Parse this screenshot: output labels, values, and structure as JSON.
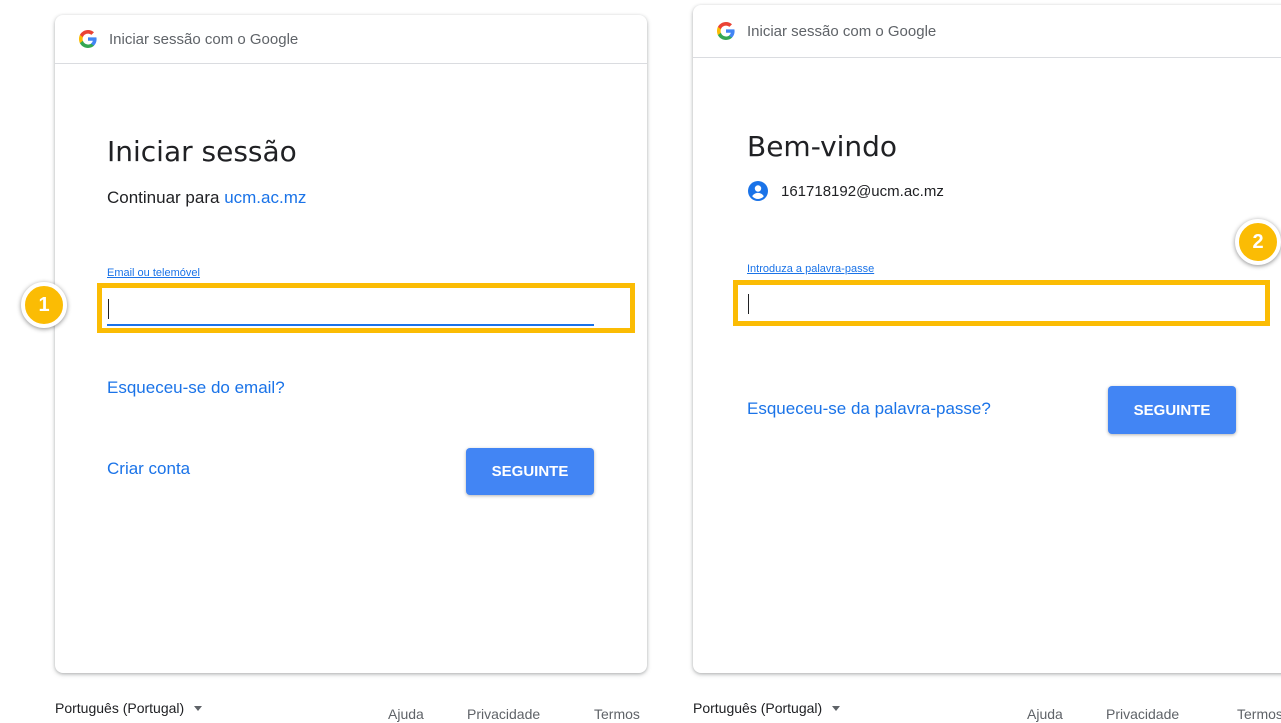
{
  "left_panel": {
    "header_text": "Iniciar sessão com o Google",
    "title": "Iniciar sessão",
    "subtitle_prefix": "Continuar para ",
    "subtitle_link": "ucm.ac.mz",
    "field_label": "Email ou telemóvel",
    "field_value": "",
    "forgot_link": "Esqueceu-se do email?",
    "create_account_link": "Criar conta",
    "next_button": "SEGUINTE",
    "step_badge": "1"
  },
  "right_panel": {
    "header_text": "Iniciar sessão com o Google",
    "title": "Bem-vindo",
    "account_email": "161718192@ucm.ac.mz",
    "field_label": "Introduza a palavra-passe",
    "field_value": "",
    "forgot_link": "Esqueceu-se da palavra-passe?",
    "next_button": "SEGUINTE",
    "step_badge": "2"
  },
  "footer_left": {
    "language": "Português (Portugal)",
    "help": "Ajuda",
    "privacy": "Privacidade",
    "terms": "Termos"
  },
  "footer_right": {
    "language": "Português (Portugal)",
    "help": "Ajuda",
    "privacy": "Privacidade",
    "terms": "Termos"
  },
  "colors": {
    "accent_blue": "#1a73e8",
    "button_blue": "#4285f4",
    "highlight_yellow": "#fbbc04"
  }
}
